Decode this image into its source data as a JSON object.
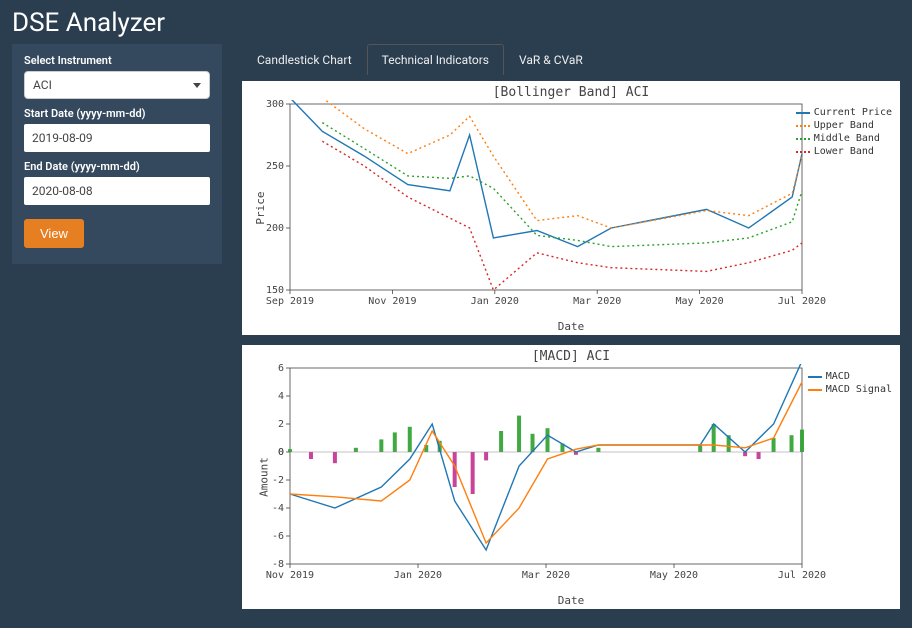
{
  "app_title": "DSE Analyzer",
  "sidebar": {
    "instrument_label": "Select Instrument",
    "instrument_value": "ACI",
    "start_label": "Start Date (yyyy-mm-dd)",
    "start_value": "2019-08-09",
    "end_label": "End Date (yyyy-mm-dd)",
    "end_value": "2020-08-08",
    "view_label": "View"
  },
  "tabs": {
    "t0": "Candlestick Chart",
    "t1": "Technical Indicators",
    "t2": "VaR & CVaR",
    "active": "t1"
  },
  "chart_data": [
    {
      "type": "line",
      "title": "[Bollinger Band] ACI",
      "xlabel": "Date",
      "ylabel": "Price",
      "ylim": [
        150,
        300
      ],
      "x_ticks": [
        "Sep 2019",
        "Nov 2019",
        "Jan 2020",
        "Mar 2020",
        "May 2020",
        "Jul 2020"
      ],
      "x": [
        "2019-08-09",
        "2019-09-01",
        "2019-10-01",
        "2019-11-01",
        "2019-12-01",
        "2019-12-15",
        "2020-01-01",
        "2020-02-01",
        "2020-03-01",
        "2020-03-25",
        "2020-06-01",
        "2020-07-01",
        "2020-08-01",
        "2020-08-08"
      ],
      "series": [
        {
          "name": "Current Price",
          "style": "solid",
          "color": "#1f77b4",
          "values": [
            305,
            278,
            258,
            235,
            230,
            275,
            192,
            198,
            185,
            200,
            215,
            200,
            225,
            260
          ]
        },
        {
          "name": "Upper Band",
          "style": "dotted",
          "color": "#ff7f0e",
          "values": [
            null,
            305,
            280,
            260,
            275,
            290,
            258,
            206,
            210,
            200,
            214,
            210,
            228,
            258
          ]
        },
        {
          "name": "Middle Band",
          "style": "dotted",
          "color": "#2ca02c",
          "values": [
            null,
            285,
            264,
            242,
            240,
            242,
            232,
            194,
            190,
            185,
            188,
            192,
            205,
            230
          ]
        },
        {
          "name": "Lower Band",
          "style": "dotted",
          "color": "#d62728",
          "values": [
            null,
            270,
            250,
            225,
            208,
            200,
            150,
            180,
            172,
            168,
            165,
            172,
            182,
            188
          ]
        }
      ]
    },
    {
      "type": "line+bar",
      "title": "[MACD] ACI",
      "xlabel": "Date",
      "ylabel": "Amount",
      "ylim": [
        -8,
        6
      ],
      "x_ticks": [
        "Nov 2019",
        "Jan 2020",
        "Mar 2020",
        "May 2020",
        "Jul 2020"
      ],
      "x": [
        "2019-09-01",
        "2019-10-01",
        "2019-11-01",
        "2019-11-20",
        "2019-12-05",
        "2019-12-20",
        "2020-01-10",
        "2020-02-01",
        "2020-02-20",
        "2020-03-10",
        "2020-03-25",
        "2020-06-01",
        "2020-06-10",
        "2020-07-01",
        "2020-07-20",
        "2020-08-08"
      ],
      "series": [
        {
          "name": "MACD",
          "style": "solid",
          "color": "#1f77b4",
          "values": [
            -3,
            -4,
            -2.5,
            -0.5,
            2,
            -3.5,
            -7,
            -1,
            1.2,
            0,
            0.5,
            0.5,
            2,
            0,
            2,
            6.5
          ]
        },
        {
          "name": "MACD Signal",
          "style": "solid",
          "color": "#ff7f0e",
          "values": [
            -3,
            -3.2,
            -3.5,
            -2,
            1.5,
            -1,
            -6.5,
            -4,
            -0.5,
            0.2,
            0.5,
            0.5,
            0.5,
            0.3,
            1,
            5
          ]
        }
      ],
      "hist": {
        "x": [
          "2019-09-01",
          "2019-09-15",
          "2019-10-01",
          "2019-10-15",
          "2019-11-01",
          "2019-11-10",
          "2019-11-20",
          "2019-12-01",
          "2019-12-10",
          "2019-12-20",
          "2020-01-01",
          "2020-01-10",
          "2020-01-20",
          "2020-02-01",
          "2020-02-10",
          "2020-02-20",
          "2020-03-01",
          "2020-03-10",
          "2020-03-25",
          "2020-06-01",
          "2020-06-10",
          "2020-06-20",
          "2020-07-01",
          "2020-07-10",
          "2020-07-20",
          "2020-08-01",
          "2020-08-08"
        ],
        "values": [
          0.2,
          -0.5,
          -0.8,
          0.3,
          0.9,
          1.4,
          1.8,
          0.5,
          0.8,
          -2.5,
          -3.0,
          -0.6,
          1.5,
          2.6,
          1.3,
          1.7,
          0.6,
          -0.2,
          0.3,
          0.5,
          2.0,
          1.2,
          -0.3,
          -0.5,
          1.0,
          1.2,
          1.6
        ],
        "pos_color": "#2ca02c",
        "neg_color": "#c42f8f"
      }
    }
  ]
}
